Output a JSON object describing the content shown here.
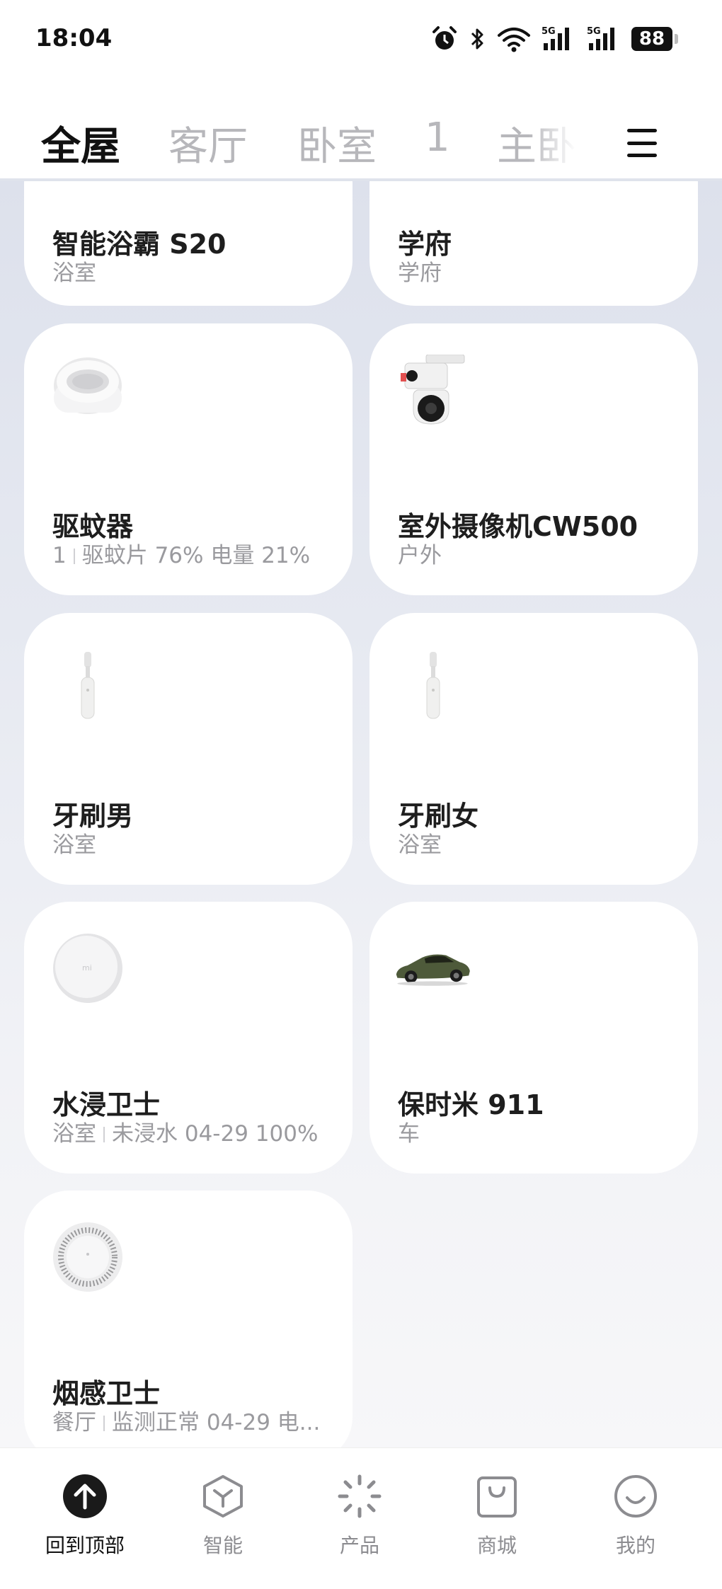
{
  "status_bar": {
    "time": "18:04",
    "icons": [
      "alarm-icon",
      "bluetooth-icon",
      "wifi-icon",
      "signal-5g-icon",
      "signal-5g-icon"
    ],
    "battery": "88"
  },
  "tabs": [
    {
      "label": "全屋",
      "active": true
    },
    {
      "label": "客厅",
      "active": false
    },
    {
      "label": "卧室",
      "active": false
    },
    {
      "label": "1",
      "active": false
    },
    {
      "label": "主卧",
      "active": false
    }
  ],
  "devices": [
    {
      "name": "智能浴霸 S20",
      "room": "浴室",
      "icon": "bath-heater-icon"
    },
    {
      "name": "学府",
      "room": "学府",
      "icon": "device-icon"
    },
    {
      "name": "驱蚊器",
      "room": "1",
      "status": "驱蚊片 76% 电量 21%",
      "icon": "mosquito-repeller-icon"
    },
    {
      "name": "室外摄像机CW500",
      "room": "户外",
      "icon": "outdoor-camera-icon"
    },
    {
      "name": "牙刷男",
      "room": "浴室",
      "icon": "toothbrush-icon"
    },
    {
      "name": "牙刷女",
      "room": "浴室",
      "icon": "toothbrush-icon"
    },
    {
      "name": "水浸卫士",
      "room": "浴室",
      "status": "未浸水 04-29 100%",
      "icon": "water-sensor-icon"
    },
    {
      "name": "保时米 911",
      "room": "车",
      "icon": "car-icon"
    },
    {
      "name": "烟感卫士",
      "room": "餐厅",
      "status": "监测正常 04-29 电...",
      "icon": "smoke-detector-icon"
    }
  ],
  "bottom_nav": [
    {
      "label": "回到顶部",
      "icon": "arrow-up-icon",
      "active": true
    },
    {
      "label": "智能",
      "icon": "smart-cube-icon",
      "active": false
    },
    {
      "label": "产品",
      "icon": "sparkle-icon",
      "active": false
    },
    {
      "label": "商城",
      "icon": "shopping-bag-icon",
      "active": false
    },
    {
      "label": "我的",
      "icon": "smiley-icon",
      "active": false
    }
  ]
}
